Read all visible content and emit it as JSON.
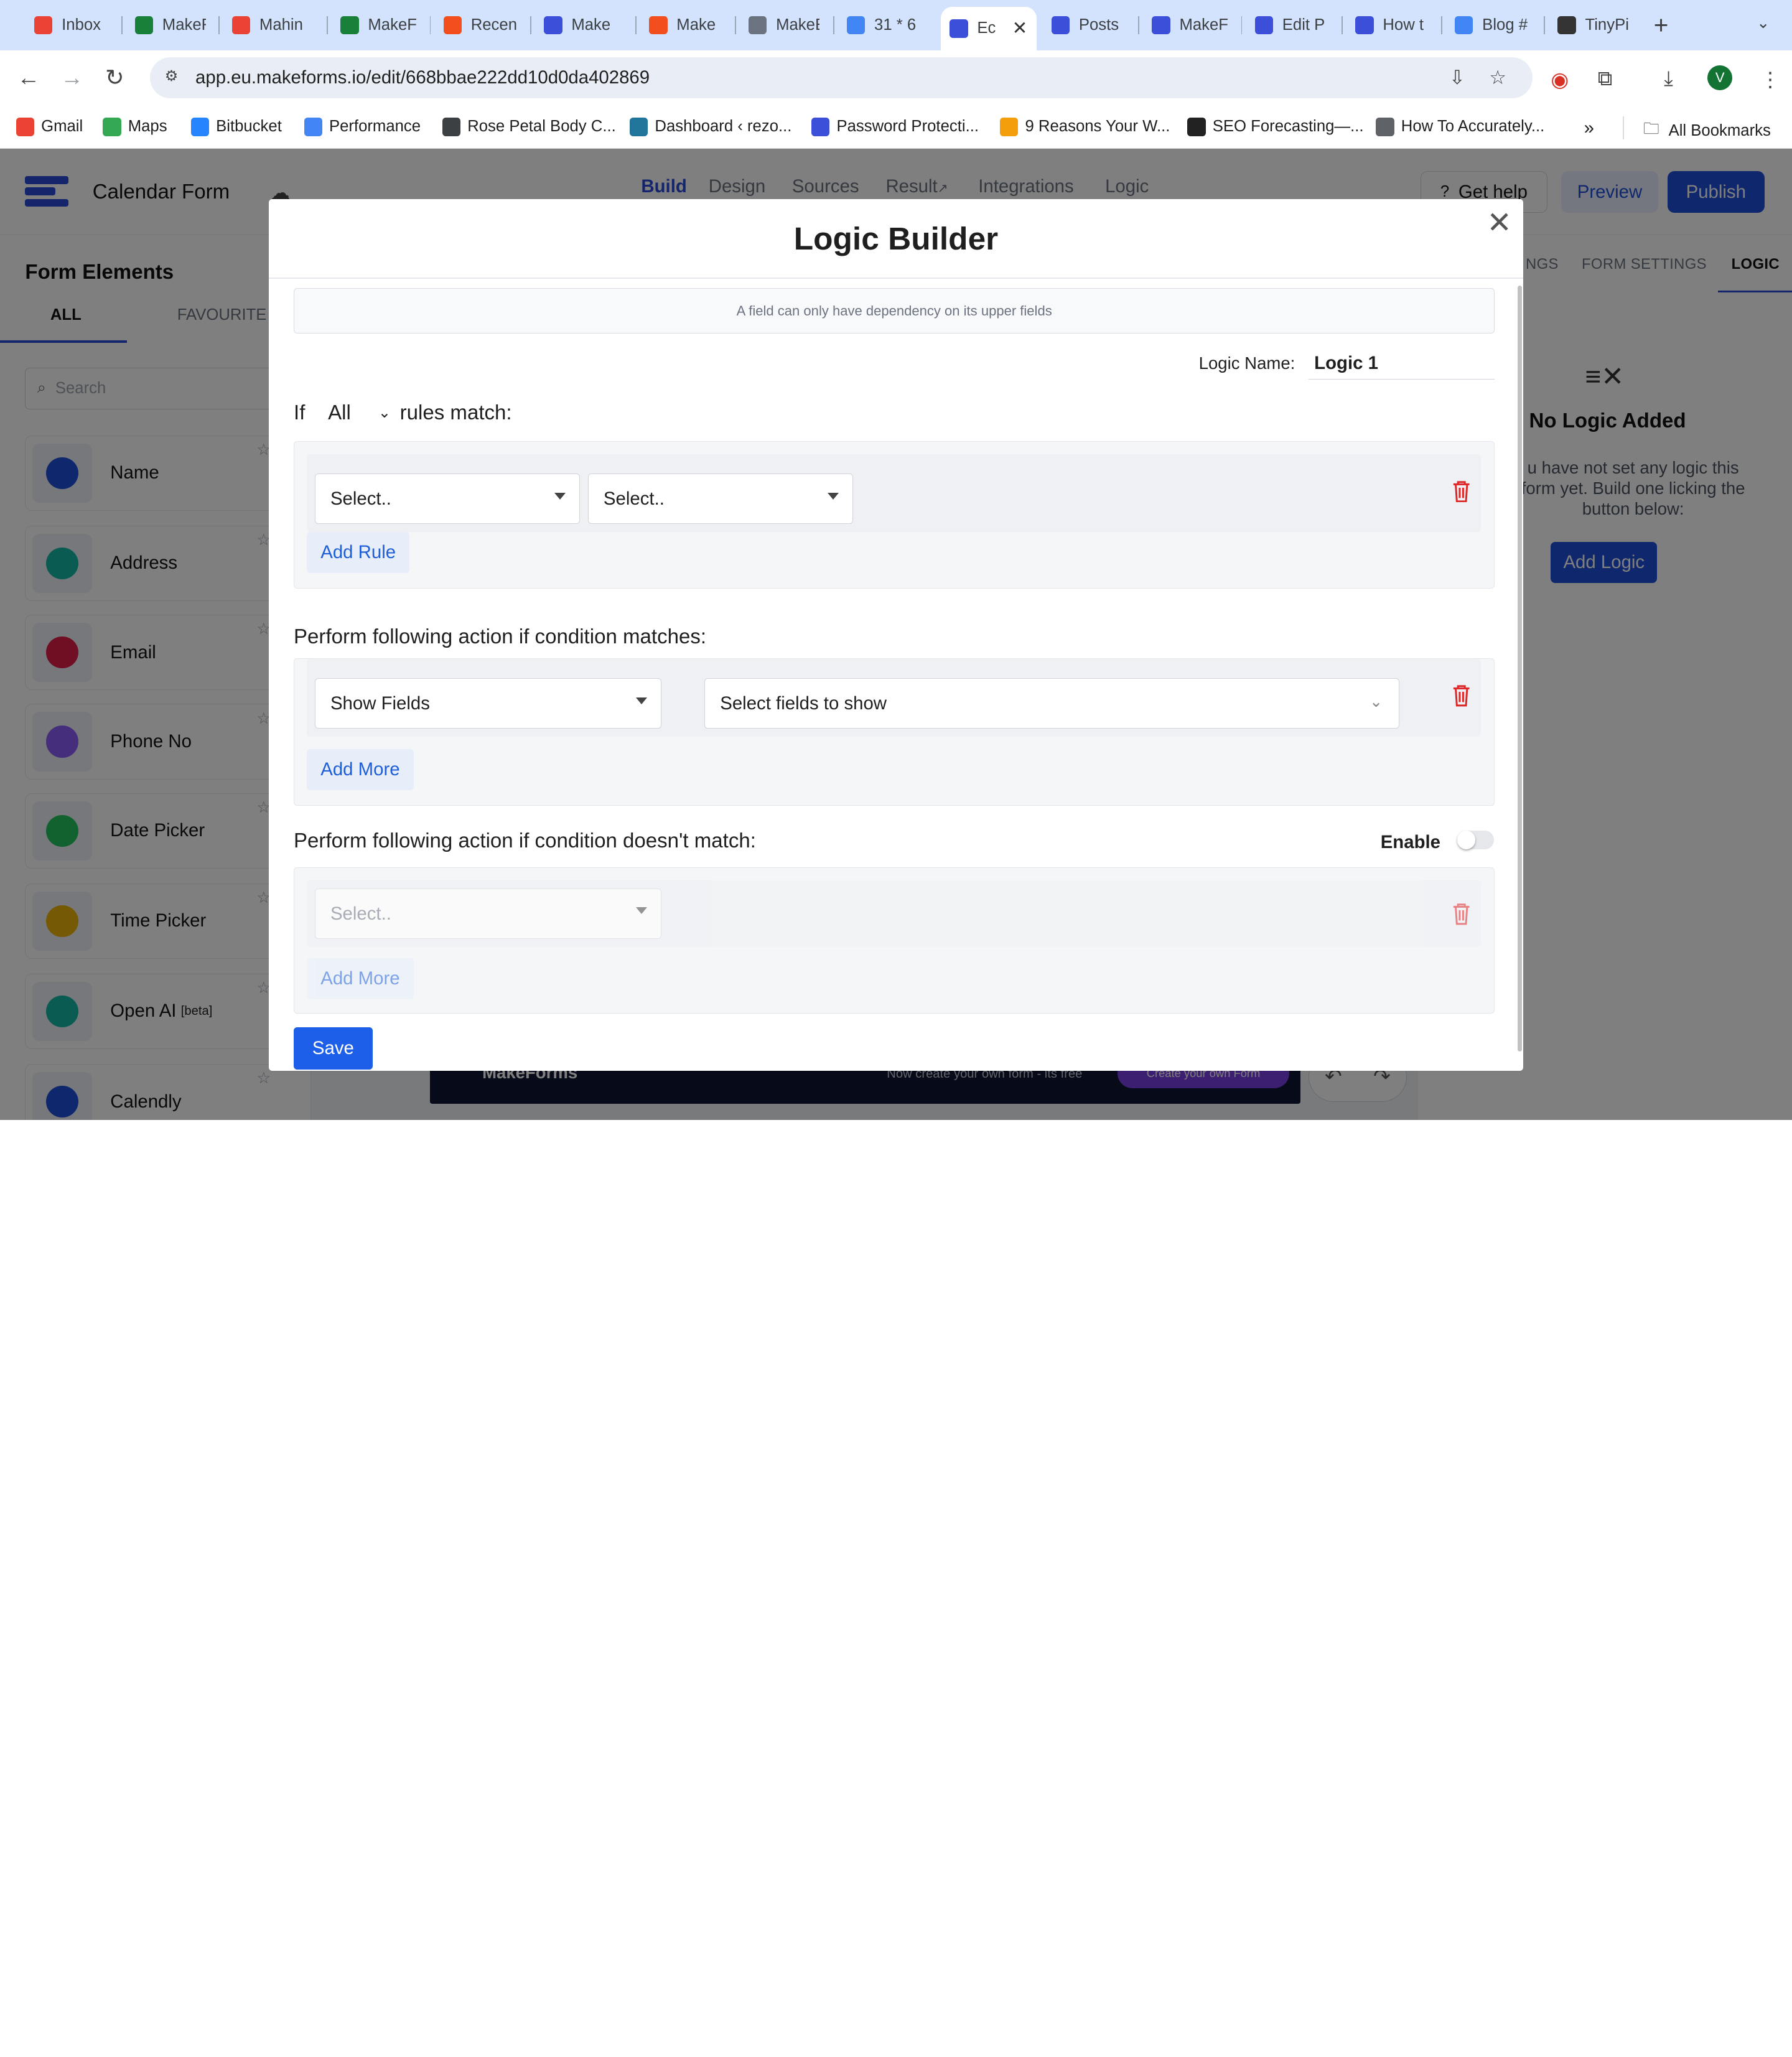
{
  "browser": {
    "tabs": [
      {
        "title": "Inbox",
        "icon": "gmail-icon",
        "color": "#ea4335"
      },
      {
        "title": "MakeF",
        "icon": "sheets-icon",
        "color": "#188038"
      },
      {
        "title": "Mahin",
        "icon": "gmail-icon",
        "color": "#ea4335"
      },
      {
        "title": "MakeF",
        "icon": "sheets-icon",
        "color": "#188038"
      },
      {
        "title": "Recen",
        "icon": "figma-icon",
        "color": "#f24e1e"
      },
      {
        "title": "Make",
        "icon": "makeforms-icon",
        "color": "#3b4fd8"
      },
      {
        "title": "Make",
        "icon": "figma-icon",
        "color": "#f24e1e"
      },
      {
        "title": "MakeE",
        "icon": "edge-icon",
        "color": "#6b7280"
      },
      {
        "title": "31 * 6",
        "icon": "google-icon",
        "color": "#4285f4"
      },
      {
        "title": "Ec",
        "icon": "makeforms-icon",
        "color": "#3b4fd8"
      },
      {
        "title": "Posts",
        "icon": "makeforms-icon",
        "color": "#3b4fd8"
      },
      {
        "title": "MakeF",
        "icon": "makeforms-icon",
        "color": "#3b4fd8"
      },
      {
        "title": "Edit P",
        "icon": "makeforms-icon",
        "color": "#3b4fd8"
      },
      {
        "title": "How t",
        "icon": "makeforms-icon",
        "color": "#3b4fd8"
      },
      {
        "title": "Blog #",
        "icon": "docs-icon",
        "color": "#4285f4"
      },
      {
        "title": "TinyPi",
        "icon": "panda-icon",
        "color": "#333333"
      }
    ],
    "url": "app.eu.makeforms.io/edit/668bbae222dd10d0da402869",
    "avatar_letter": "V",
    "bookmarks": [
      {
        "label": "Gmail",
        "icon": "gmail-icon",
        "color": "#ea4335"
      },
      {
        "label": "Maps",
        "icon": "maps-icon",
        "color": "#34a853"
      },
      {
        "label": "Bitbucket",
        "icon": "bitbucket-icon",
        "color": "#2684ff"
      },
      {
        "label": "Performance",
        "icon": "performance-icon",
        "color": "#4285f4"
      },
      {
        "label": "Rose Petal Body C...",
        "icon": "camera-icon",
        "color": "#3c4043"
      },
      {
        "label": "Dashboard ‹ rezo...",
        "icon": "wordpress-icon",
        "color": "#21759b"
      },
      {
        "label": "Password Protecti...",
        "icon": "makeforms-icon",
        "color": "#3b4fd8"
      },
      {
        "label": "9 Reasons Your W...",
        "icon": "a-icon",
        "color": "#f59e0b"
      },
      {
        "label": "SEO Forecasting—...",
        "icon": "seo-icon",
        "color": "#222222"
      },
      {
        "label": "How To Accurately...",
        "icon": "globe-icon",
        "color": "#5f6368"
      }
    ],
    "all_bookmarks": "All Bookmarks"
  },
  "app": {
    "form_name": "Calendar Form",
    "nav": [
      "Build",
      "Design",
      "Sources",
      "Result",
      "Integrations",
      "Logic"
    ],
    "get_help": "Get help",
    "preview": "Preview",
    "publish": "Publish",
    "sidebar": {
      "title": "Form Elements",
      "tabs": [
        "ALL",
        "FAVOURITE"
      ],
      "search_placeholder": "Search",
      "elements": [
        {
          "label": "Name",
          "icon": "name-icon",
          "color": "#1e4fd8"
        },
        {
          "label": "Address",
          "icon": "address-icon",
          "color": "#14b8a6"
        },
        {
          "label": "Email",
          "icon": "email-icon",
          "color": "#e11d48"
        },
        {
          "label": "Phone No",
          "icon": "phone-icon",
          "color": "#8b5cf6"
        },
        {
          "label": "Date Picker",
          "icon": "date-picker-icon",
          "color": "#22c55e"
        },
        {
          "label": "Time Picker",
          "icon": "time-picker-icon",
          "color": "#eab308"
        },
        {
          "label": "Open AI",
          "badge": "[beta]",
          "icon": "openai-icon",
          "color": "#14b8a6"
        },
        {
          "label": "Calendly",
          "icon": "calendly-icon",
          "color": "#1e4fd8"
        }
      ]
    },
    "right_tabs": [
      "NGS",
      "FORM SETTINGS",
      "LOGIC"
    ],
    "no_logic_title": "No Logic Added",
    "no_logic_text": "u have not set any logic this form yet. Build one licking the button below:",
    "add_logic": "Add Logic",
    "banner": {
      "brand": "MakeForms",
      "text": "Now create your own form - its free",
      "button": "Create your own Form"
    }
  },
  "modal": {
    "title": "Logic Builder",
    "note": "A field can only have dependency on its upper fields",
    "logic_name_label": "Logic Name:",
    "logic_name": "Logic 1",
    "if_label": "If",
    "match_mode": "All",
    "rules_match": "rules match:",
    "rule_selects": [
      "Select..",
      "Select.."
    ],
    "add_rule": "Add Rule",
    "action_header": "Perform following action if condition matches:",
    "action_type": "Show Fields",
    "action_target_placeholder": "Select fields to show",
    "add_more": "Add More",
    "else_header": "Perform following action if condition doesn't match:",
    "enable_label": "Enable",
    "enable_on": false,
    "else_select": "Select..",
    "save": "Save"
  }
}
